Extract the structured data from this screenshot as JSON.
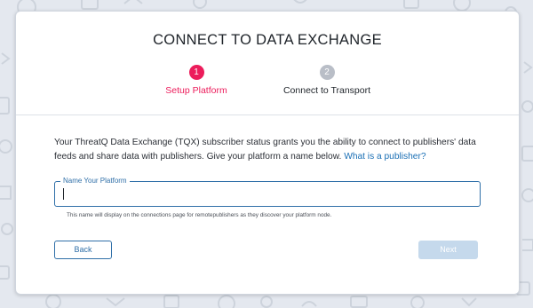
{
  "modal": {
    "title": "CONNECT TO DATA EXCHANGE"
  },
  "steps": [
    {
      "number": "1",
      "label": "Setup Platform",
      "state": "active",
      "color": "#ec1c5b"
    },
    {
      "number": "2",
      "label": "Connect to Transport",
      "state": "inactive",
      "color": "#b9bec7"
    }
  ],
  "description": {
    "text": "Your ThreatQ Data Exchange (TQX) subscriber status grants you the ability to connect to publishers' data feeds and share data with publishers. Give your platform a name below.",
    "link_text": "What is a publisher?"
  },
  "platform_name_field": {
    "label": "Name Your Platform",
    "value": "",
    "helper": "This name will display on the connections page for remotepublishers as they discover your platform node."
  },
  "buttons": {
    "back": "Back",
    "next": "Next",
    "next_disabled": true
  },
  "colors": {
    "accent": "#2f6fa8",
    "active_step": "#ec1c5b",
    "link": "#1a6fb5",
    "disabled_button": "#c5d9ec"
  }
}
